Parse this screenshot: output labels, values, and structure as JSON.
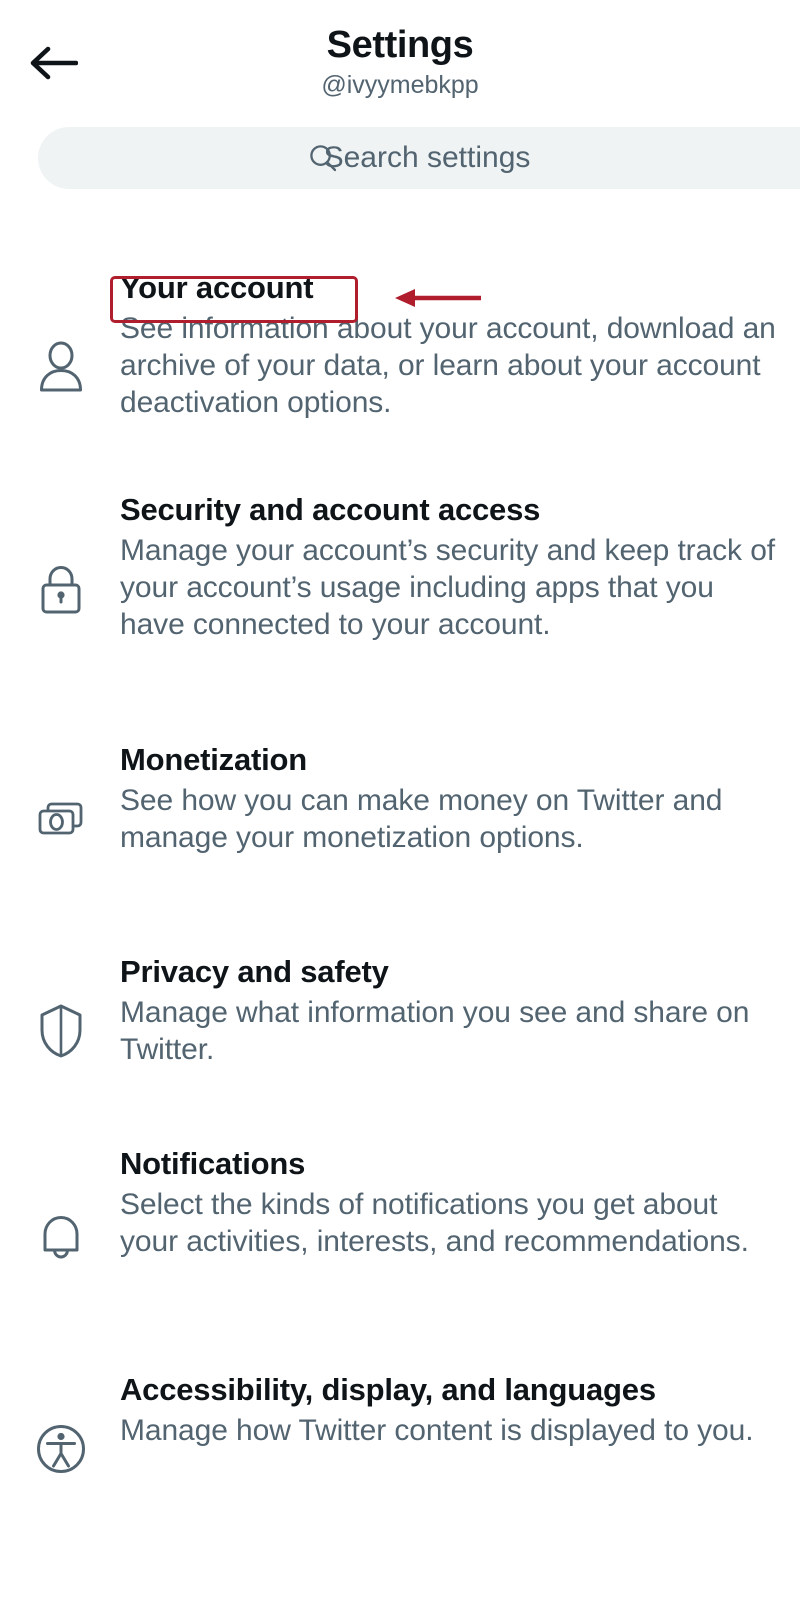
{
  "header": {
    "back_icon": "back-arrow-icon",
    "title": "Settings",
    "handle": "@ivyymebkpp"
  },
  "search": {
    "icon": "search-icon",
    "placeholder": "Search settings",
    "value": ""
  },
  "settings": [
    {
      "icon": "person-icon",
      "title": "Your account",
      "description": "See information about your account, download an archive of your data, or learn about your account deactivation options."
    },
    {
      "icon": "lock-icon",
      "title": "Security and account access",
      "description": "Manage your account’s security and keep track of your account’s usage including apps that you have connected to your account."
    },
    {
      "icon": "money-icon",
      "title": "Monetization",
      "description": "See how you can make money on Twitter and manage your monetization options."
    },
    {
      "icon": "shield-icon",
      "title": "Privacy and safety",
      "description": "Manage what information you see and share on Twitter."
    },
    {
      "icon": "bell-icon",
      "title": "Notifications",
      "description": "Select the kinds of notifications you get about your activities, interests, and recommendations."
    },
    {
      "icon": "accessibility-icon",
      "title": "Accessibility, display, and languages",
      "description": "Manage how Twitter content is displayed to you."
    }
  ],
  "annotation": {
    "highlight_target": "Your account",
    "color": "#b01e2e",
    "arrow_direction": "left"
  },
  "colors": {
    "title_text": "#0f1419",
    "secondary_text": "#536471",
    "search_background": "#eff3f4",
    "icon_stroke": "#536471",
    "annotation": "#b01e2e",
    "page_background": "#ffffff"
  }
}
